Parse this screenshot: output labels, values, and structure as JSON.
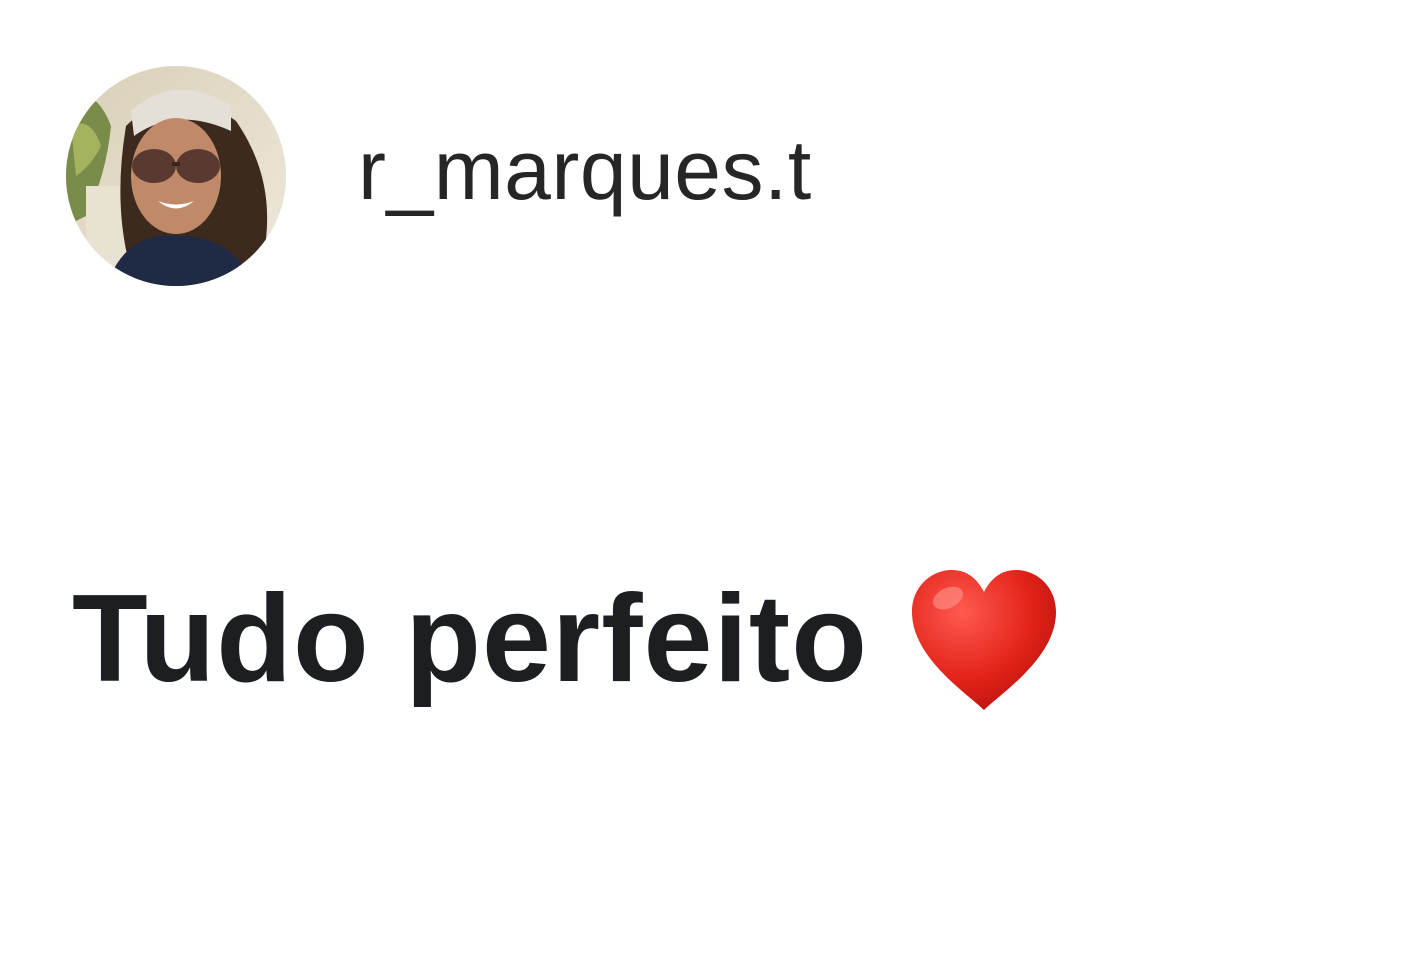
{
  "profile": {
    "username": "r_marques.t",
    "avatar_icon": "profile-photo-avatar"
  },
  "message": {
    "text": "Tudo perfeito",
    "emoji_icon": "red-heart-icon",
    "emoji_color": "#e2231a"
  },
  "colors": {
    "background": "#ffffff",
    "username_text": "#262626",
    "message_text": "#1c1e21"
  }
}
